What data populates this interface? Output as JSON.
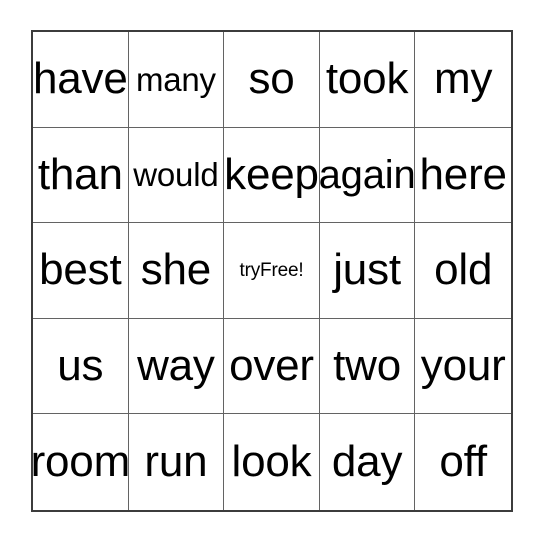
{
  "card": {
    "type": "bingo-card",
    "columns": 5,
    "rows": 5,
    "background_color": "#ffffff",
    "text_color": "#000000",
    "outer_border_color": "#3c3c3c",
    "grid_line_color": "#636363",
    "free_space": {
      "row": 2,
      "column": 2,
      "label": "tryFree!"
    },
    "grid": [
      [
        {
          "label": "have",
          "size": "xl"
        },
        {
          "label": "many",
          "size": "md"
        },
        {
          "label": "so",
          "size": "xl"
        },
        {
          "label": "took",
          "size": "xl"
        },
        {
          "label": "my",
          "size": "xl"
        }
      ],
      [
        {
          "label": "than",
          "size": "xl"
        },
        {
          "label": "would",
          "size": "md"
        },
        {
          "label": "keep",
          "size": "xl"
        },
        {
          "label": "again",
          "size": "lg"
        },
        {
          "label": "here",
          "size": "xl"
        }
      ],
      [
        {
          "label": "best",
          "size": "xl"
        },
        {
          "label": "she",
          "size": "xl"
        },
        {
          "label": "tryFree!",
          "size": "sm"
        },
        {
          "label": "just",
          "size": "xl"
        },
        {
          "label": "old",
          "size": "xl"
        }
      ],
      [
        {
          "label": "us",
          "size": "xl"
        },
        {
          "label": "way",
          "size": "xl"
        },
        {
          "label": "over",
          "size": "xl"
        },
        {
          "label": "two",
          "size": "xl"
        },
        {
          "label": "your",
          "size": "xl"
        }
      ],
      [
        {
          "label": "room",
          "size": "xl"
        },
        {
          "label": "run",
          "size": "xl"
        },
        {
          "label": "look",
          "size": "xl"
        },
        {
          "label": "day",
          "size": "xl"
        },
        {
          "label": "off",
          "size": "xl"
        }
      ]
    ]
  }
}
